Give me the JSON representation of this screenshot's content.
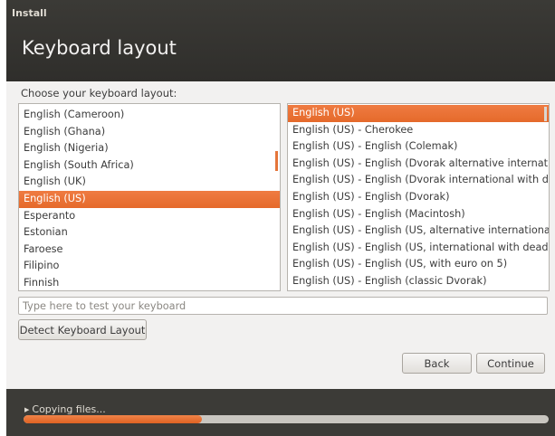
{
  "window": {
    "title": "Install"
  },
  "page": {
    "heading": "Keyboard layout"
  },
  "layout_chooser": {
    "label": "Choose your keyboard layout:",
    "layouts": [
      {
        "label": "English (Cameroon)",
        "selected": false
      },
      {
        "label": "English (Ghana)",
        "selected": false
      },
      {
        "label": "English (Nigeria)",
        "selected": false
      },
      {
        "label": "English (South Africa)",
        "selected": false
      },
      {
        "label": "English (UK)",
        "selected": false
      },
      {
        "label": "English (US)",
        "selected": true
      },
      {
        "label": "Esperanto",
        "selected": false
      },
      {
        "label": "Estonian",
        "selected": false
      },
      {
        "label": "Faroese",
        "selected": false
      },
      {
        "label": "Filipino",
        "selected": false
      },
      {
        "label": "Finnish",
        "selected": false
      }
    ],
    "variants": [
      {
        "label": "English (US)",
        "selected": true
      },
      {
        "label": "English (US) - Cherokee",
        "selected": false
      },
      {
        "label": "English (US) - English (Colemak)",
        "selected": false
      },
      {
        "label": "English (US) - English (Dvorak alternative international",
        "selected": false
      },
      {
        "label": "English (US) - English (Dvorak international with dead",
        "selected": false
      },
      {
        "label": "English (US) - English (Dvorak)",
        "selected": false
      },
      {
        "label": "English (US) - English (Macintosh)",
        "selected": false
      },
      {
        "label": "English (US) - English (US, alternative international)",
        "selected": false
      },
      {
        "label": "English (US) - English (US, international with dead key",
        "selected": false
      },
      {
        "label": "English (US) - English (US, with euro on 5)",
        "selected": false
      },
      {
        "label": "English (US) - English (classic Dvorak)",
        "selected": false
      }
    ]
  },
  "test_field": {
    "placeholder": "Type here to test your keyboard",
    "value": ""
  },
  "buttons": {
    "detect": "Detect Keyboard Layout",
    "back": "Back",
    "continue": "Continue"
  },
  "footer": {
    "status": "Copying files...",
    "progress": 0.34
  },
  "colors": {
    "accent": "#e9703a",
    "titlebar": "#3b3a36",
    "background": "#f2f1f0"
  },
  "icons": {
    "expander": "disclosure-triangle-right-icon"
  }
}
